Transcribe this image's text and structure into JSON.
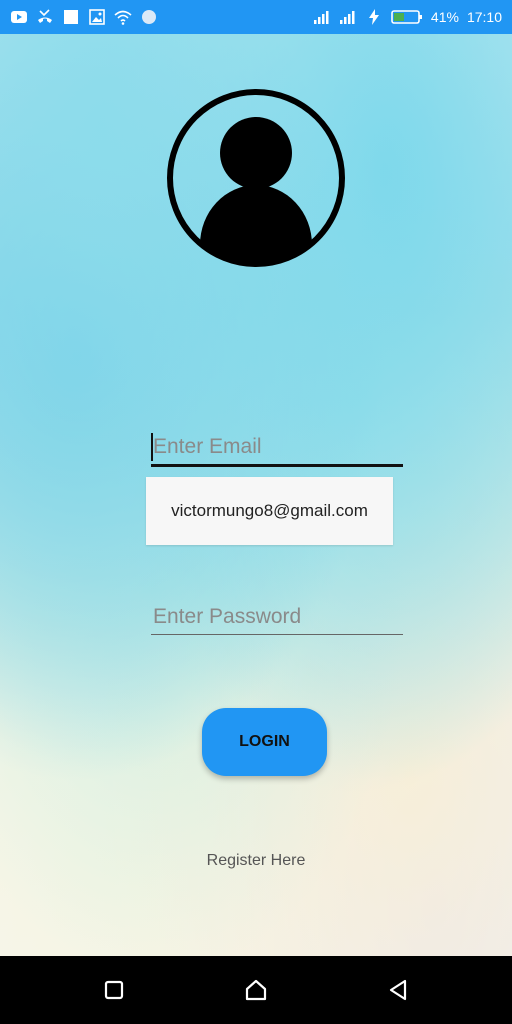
{
  "status_bar": {
    "battery_percent": "41%",
    "time": "17:10",
    "icons": [
      "youtube-icon",
      "missed-call-icon",
      "square-notification-icon",
      "gallery-icon",
      "wifi-icon",
      "circle-notification-icon",
      "signal-icon",
      "signal-icon",
      "charging-icon",
      "battery-icon"
    ]
  },
  "login_form": {
    "email_placeholder": "Enter Email",
    "email_value": "",
    "autofill_suggestion": "victormungo8@gmail.com",
    "password_placeholder": "Enter Password",
    "password_value": "",
    "login_label": "LOGIN",
    "register_label": "Register Here"
  },
  "nav_bar": {
    "buttons": [
      "recents-button",
      "home-button",
      "back-button"
    ]
  },
  "colors": {
    "primary": "#2196F3",
    "nav_bar": "#000000",
    "text_dark": "#111111",
    "placeholder": "#8a8a8a"
  }
}
